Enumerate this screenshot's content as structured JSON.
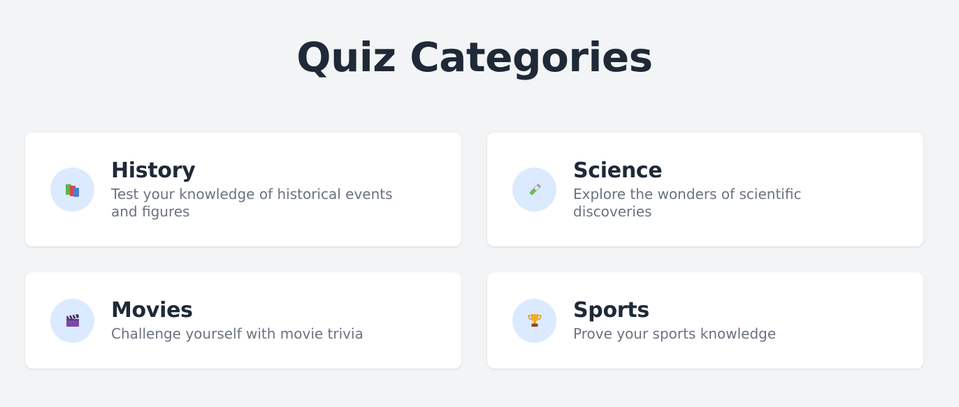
{
  "page": {
    "title": "Quiz Categories"
  },
  "categories": [
    {
      "title": "History",
      "description": "Test your knowledge of historical events and figures",
      "icon": "books-icon"
    },
    {
      "title": "Science",
      "description": "Explore the wonders of scientific discoveries",
      "icon": "test-tube-icon"
    },
    {
      "title": "Movies",
      "description": "Challenge yourself with movie trivia",
      "icon": "clapperboard-icon"
    },
    {
      "title": "Sports",
      "description": "Prove your sports knowledge",
      "icon": "trophy-icon"
    }
  ],
  "colors": {
    "background": "#f2f4f6",
    "card": "#ffffff",
    "icon_circle": "#dbeafe",
    "title_text": "#1f2937",
    "description_text": "#6b7280"
  }
}
